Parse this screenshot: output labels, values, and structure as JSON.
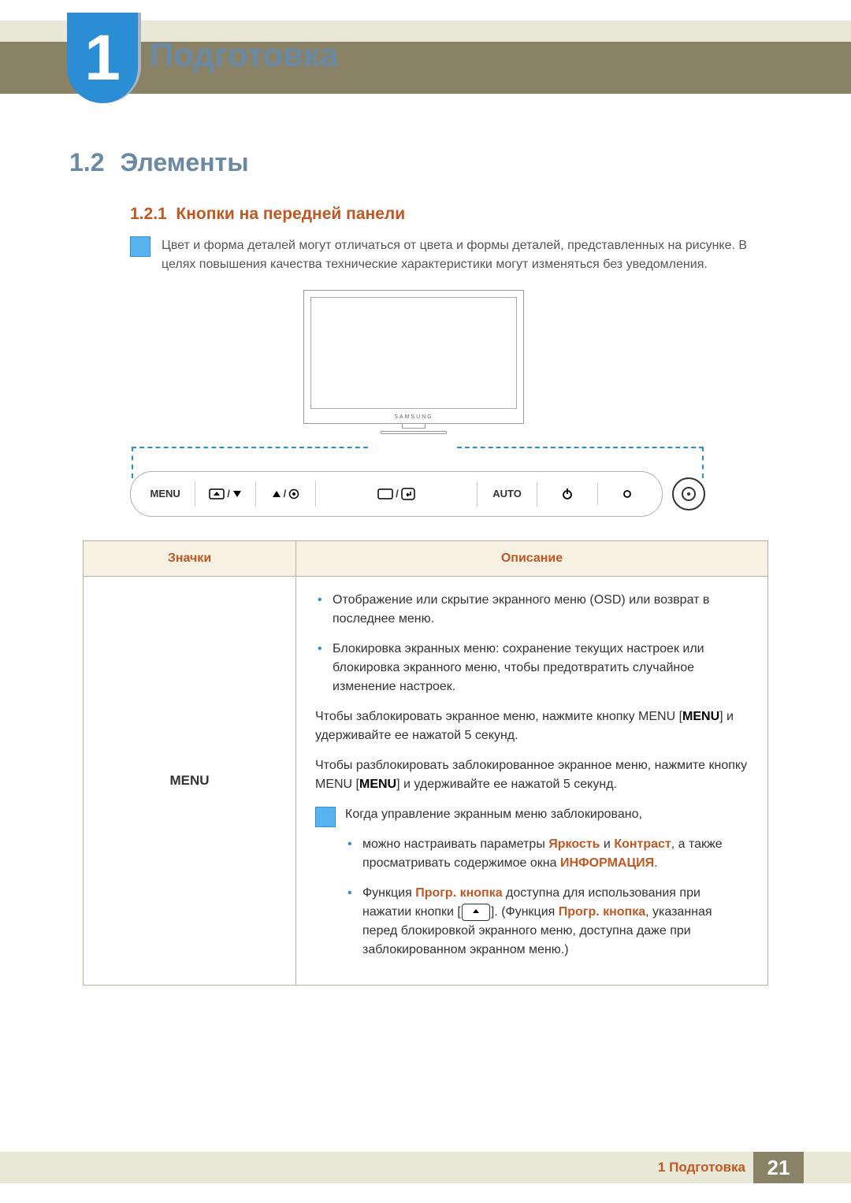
{
  "chapter": {
    "number": "1",
    "title": "Подготовка"
  },
  "section": {
    "number": "1.2",
    "title": "Элементы"
  },
  "subsection": {
    "number": "1.2.1",
    "title": "Кнопки на передней панели"
  },
  "top_note": "Цвет и форма деталей могут отличаться от цвета и формы деталей, представленных на рисунке. В целях повышения качества технические характеристики могут изменяться без уведомления.",
  "monitor_brand": "SAMSUNG",
  "button_bar": {
    "menu": "MENU",
    "auto": "AUTO"
  },
  "table": {
    "headers": {
      "left": "Значки",
      "right": "Описание"
    },
    "row1": {
      "label": "MENU",
      "bullet1": "Отображение или скрытие экранного меню (OSD) или возврат в последнее меню.",
      "bullet2": "Блокировка экранных меню: сохранение текущих настроек или блокировка экранного меню, чтобы предотвратить случайное изменение настроек.",
      "para1_a": "Чтобы заблокировать экранное меню, нажмите кнопку MENU [",
      "para1_kw": "MENU",
      "para1_b": "] и удерживайте ее нажатой 5 секунд.",
      "para2_a": "Чтобы разблокировать заблокированное экранное меню, нажмите кнопку MENU [",
      "para2_kw": "MENU",
      "para2_b": "] и удерживайте ее нажатой 5 секунд.",
      "note_intro": "Когда управление экранным меню заблокировано,",
      "note_b1_a": "можно настраивать параметры ",
      "note_b1_kw1": "Яркость",
      "note_b1_mid": " и ",
      "note_b1_kw2": "Контраст",
      "note_b1_b": ", а также просматривать содержимое окна ",
      "note_b1_kw3": "ИНФОРМАЦИЯ",
      "note_b1_end": ".",
      "note_b2_a": "Функция ",
      "note_b2_kw1": "Прогр. кнопка",
      "note_b2_b": " доступна для использования при нажатии кнопки [",
      "note_b2_c": "]. (Функция ",
      "note_b2_kw2": "Прогр. кнопка",
      "note_b2_d": ", указанная перед блокировкой экранного меню, доступна даже при заблокированном экранном меню.)"
    }
  },
  "footer": {
    "text": "1 Подготовка",
    "page": "21"
  }
}
